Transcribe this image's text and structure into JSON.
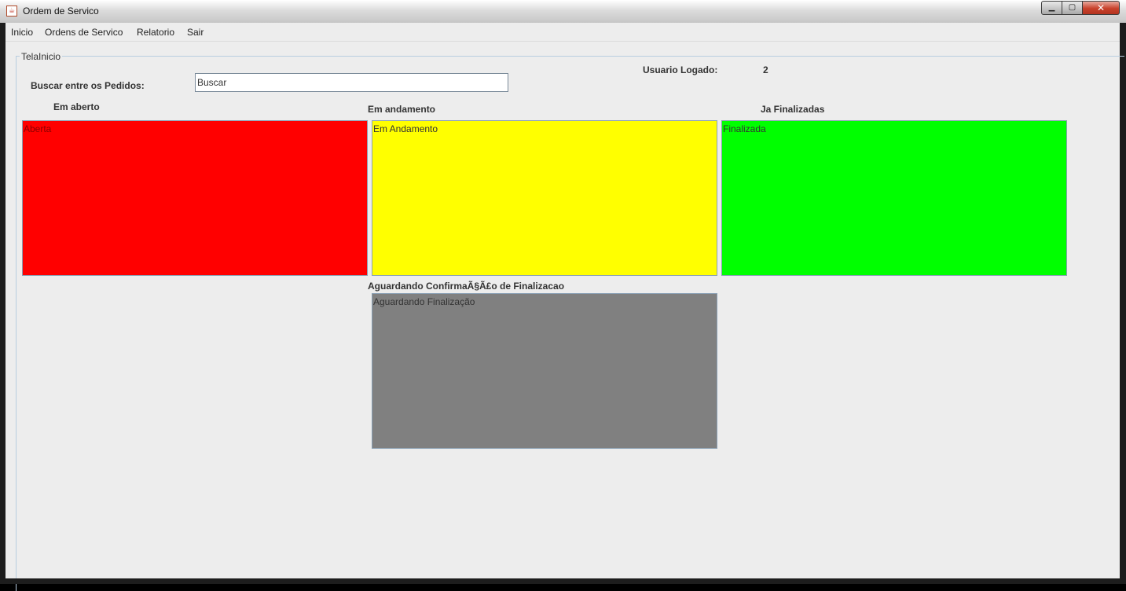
{
  "window": {
    "title": "Ordem de Servico",
    "icon": "java-cup-icon",
    "controls": {
      "minimize": "minimize-icon",
      "maximize": "maximize-icon",
      "close": "close-icon"
    }
  },
  "menu": {
    "items": [
      {
        "label": "Inicio"
      },
      {
        "label": "Ordens de Servico"
      },
      {
        "label": "Relatorio"
      },
      {
        "label": "Sair"
      }
    ]
  },
  "panel": {
    "title": "TelaInicio",
    "search_label": "Buscar entre os Pedidos:",
    "search_value": "Buscar",
    "user_label": "Usuario Logado:",
    "user_value": "2"
  },
  "columns": {
    "open": {
      "heading": "Em aberto",
      "box_text": "Aberta",
      "color": "#ff0000",
      "text_color": "#8b0000"
    },
    "in_progress": {
      "heading": "Em andamento",
      "box_text": "Em Andamento",
      "color": "#ffff00",
      "text_color": "#333333"
    },
    "finished": {
      "heading": "Ja Finalizadas",
      "box_text": "Finalizada",
      "color": "#00ff00",
      "text_color": "#333333"
    },
    "awaiting": {
      "heading": "Aguardando ConfirmaÃ§Ã£o de Finalizacao",
      "box_text": "Aguardando Finalização",
      "color": "#808080",
      "text_color": "#333333"
    }
  }
}
